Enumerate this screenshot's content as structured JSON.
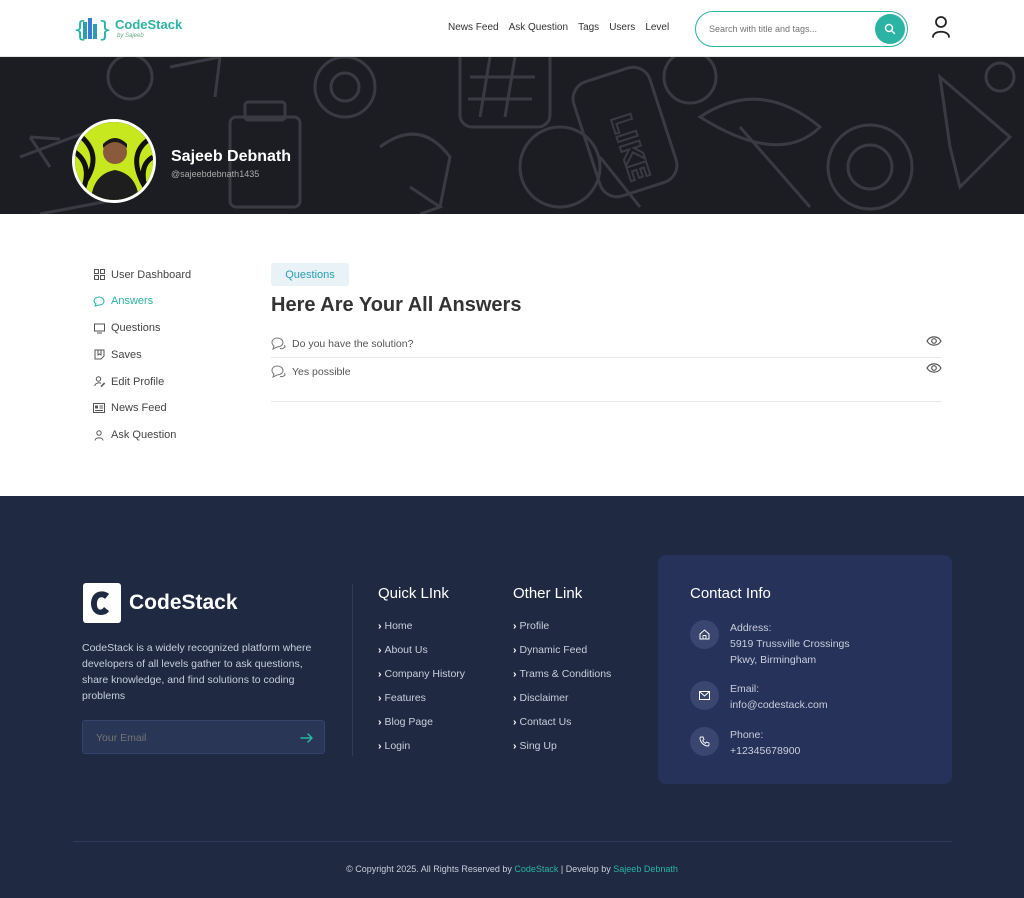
{
  "header": {
    "logo_name": "CodeStack",
    "logo_by": "by Sajeeb",
    "nav": [
      "News Feed",
      "Ask Question",
      "Tags",
      "Users",
      "Level"
    ],
    "search_placeholder": "Search with title and tags..."
  },
  "profile": {
    "name": "Sajeeb Debnath",
    "handle": "@sajeebdebnath1435"
  },
  "sidebar": {
    "items": [
      {
        "label": "User Dashboard",
        "icon": "grid-icon"
      },
      {
        "label": "Answers",
        "icon": "chat-icon"
      },
      {
        "label": "Questions",
        "icon": "monitor-icon"
      },
      {
        "label": "Saves",
        "icon": "bookmark-icon"
      },
      {
        "label": "Edit Profile",
        "icon": "user-edit-icon"
      },
      {
        "label": "News Feed",
        "icon": "newspaper-icon"
      },
      {
        "label": "Ask Question",
        "icon": "user-question-icon"
      }
    ],
    "active_index": 1
  },
  "main": {
    "tab": "Questions",
    "title": "Here Are Your All Answers",
    "answers": [
      {
        "text": "Do you have the solution?"
      },
      {
        "text": "Yes possible"
      }
    ]
  },
  "footer": {
    "logo_name": "CodeStack",
    "description": "CodeStack is a widely recognized platform where developers of all levels gather to ask questions, share knowledge, and find solutions to coding problems",
    "email_placeholder": "Your Email",
    "quick_links": {
      "title": "Quick LInk",
      "items": [
        "Home",
        "About Us",
        "Company History",
        "Features",
        "Blog Page",
        "Login"
      ]
    },
    "other_links": {
      "title": "Other Link",
      "items": [
        "Profile",
        "Dynamic Feed",
        "Trams & Conditions",
        "Disclaimer",
        "Contact Us",
        "Sing Up"
      ]
    },
    "contact": {
      "title": "Contact Info",
      "address_label": "Address:",
      "address_line1": "5919 Trussville Crossings",
      "address_line2": "Pkwy, Birmingham",
      "email_label": "Email:",
      "email": "info@codestack.com",
      "phone_label": "Phone:",
      "phone": "+12345678900"
    },
    "copyright_prefix": "© Copyright 2025. All Rights Reserved by",
    "copyright_brand": "CodeStack",
    "copyright_sep": "| Develop by",
    "copyright_author": "Sajeeb Debnath"
  },
  "colors": {
    "accent": "#2bb3a3",
    "footer_bg": "#1f2942",
    "banner_bg": "#1c1d22"
  }
}
